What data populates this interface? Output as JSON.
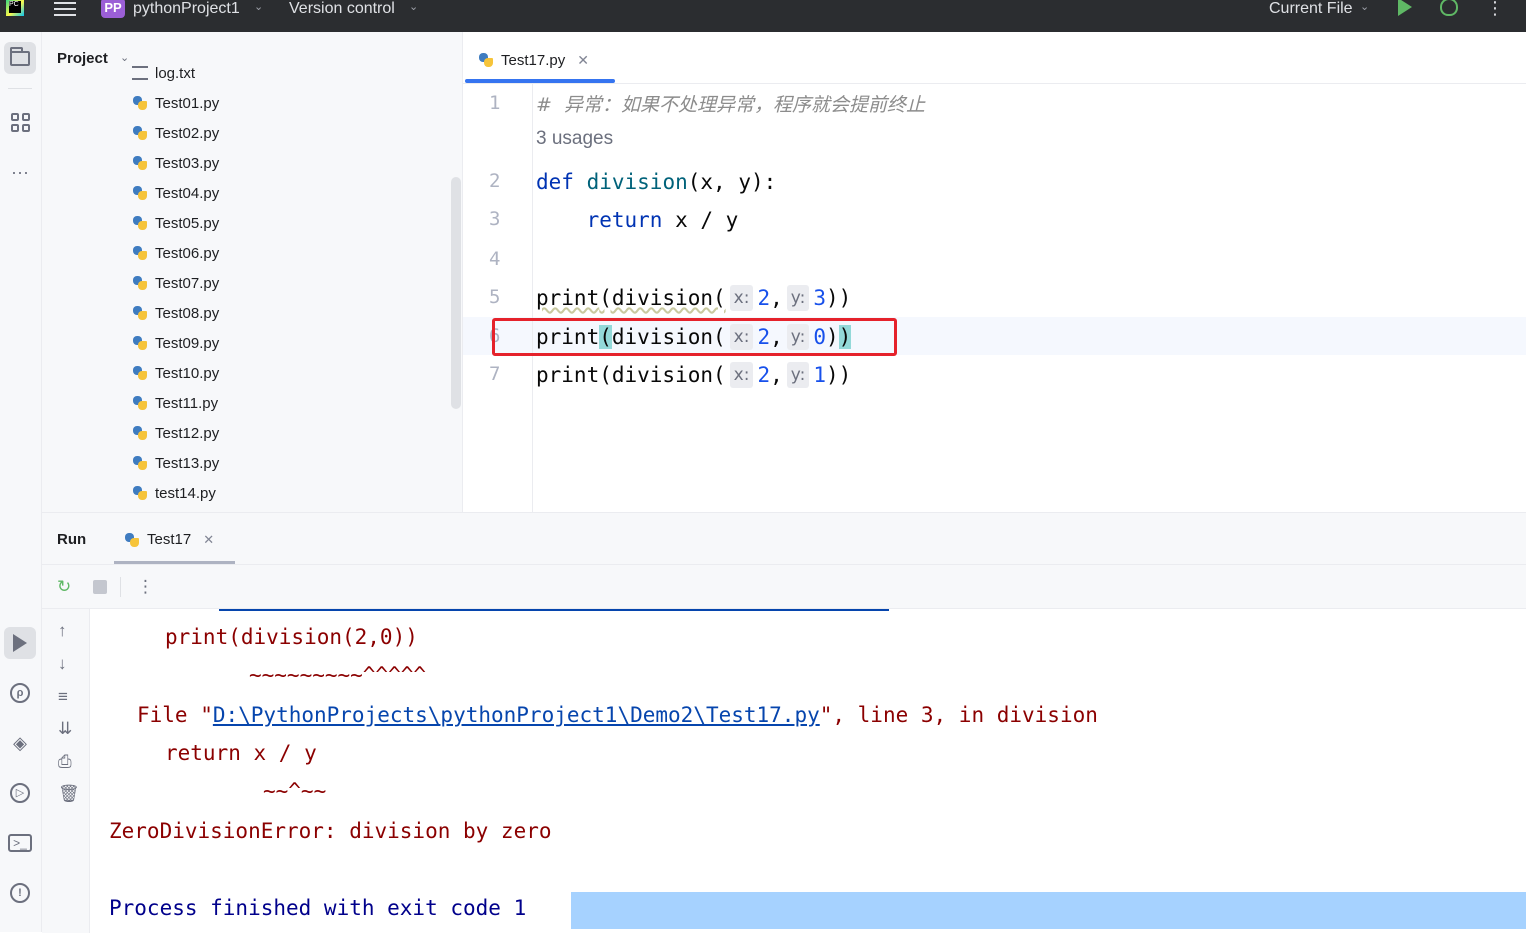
{
  "titlebar": {
    "project_badge": "PP",
    "project_name": "pythonProject1",
    "vcs_label": "Version control",
    "run_config": "Current File",
    "app_logo_text": "PC"
  },
  "project_panel": {
    "title": "Project",
    "files": [
      "log.txt",
      "Test01.py",
      "Test02.py",
      "Test03.py",
      "Test04.py",
      "Test05.py",
      "Test06.py",
      "Test07.py",
      "Test08.py",
      "Test09.py",
      "Test10.py",
      "Test11.py",
      "Test12.py",
      "Test13.py",
      "test14.py"
    ]
  },
  "editor": {
    "tab_label": "Test17.py",
    "line_numbers": [
      "1",
      "2",
      "3",
      "4",
      "5",
      "6",
      "7"
    ],
    "comment": "#  异常：如果不处理异常，程序就会提前终止",
    "usages": "3 usages",
    "def_kw": "def",
    "func_name": "division",
    "def_params": "(x, y):",
    "return_kw": "return",
    "return_expr": " x / y",
    "print_kw": "print",
    "call_open": "(division(",
    "hint_x": "x:",
    "hint_y": "y:",
    "arg_x": "2",
    "comma": ",",
    "args_y": [
      "3",
      "0",
      "1"
    ],
    "call_close": "))"
  },
  "run_panel": {
    "title": "Run",
    "tab_label": "Test17",
    "console": {
      "line1": "print(division(2,0))",
      "line2": "~~~~~~~~~^^^^^",
      "file_prefix": "File \"",
      "file_path": "D:\\PythonProjects\\pythonProject1\\Demo2\\Test17.py",
      "file_suffix": "\", line 3, in division",
      "line4": "return x / y",
      "line5": "~~^~~",
      "error": "ZeroDivisionError: division by zero",
      "process": "Process finished with exit code 1"
    }
  },
  "colors": {
    "keyword": "#0033b3",
    "function": "#00627a",
    "number": "#1750eb",
    "error_text": "#8b0000",
    "link": "#0645ad",
    "selection": "#a6d2ff",
    "highlight_box": "#e5222b"
  }
}
